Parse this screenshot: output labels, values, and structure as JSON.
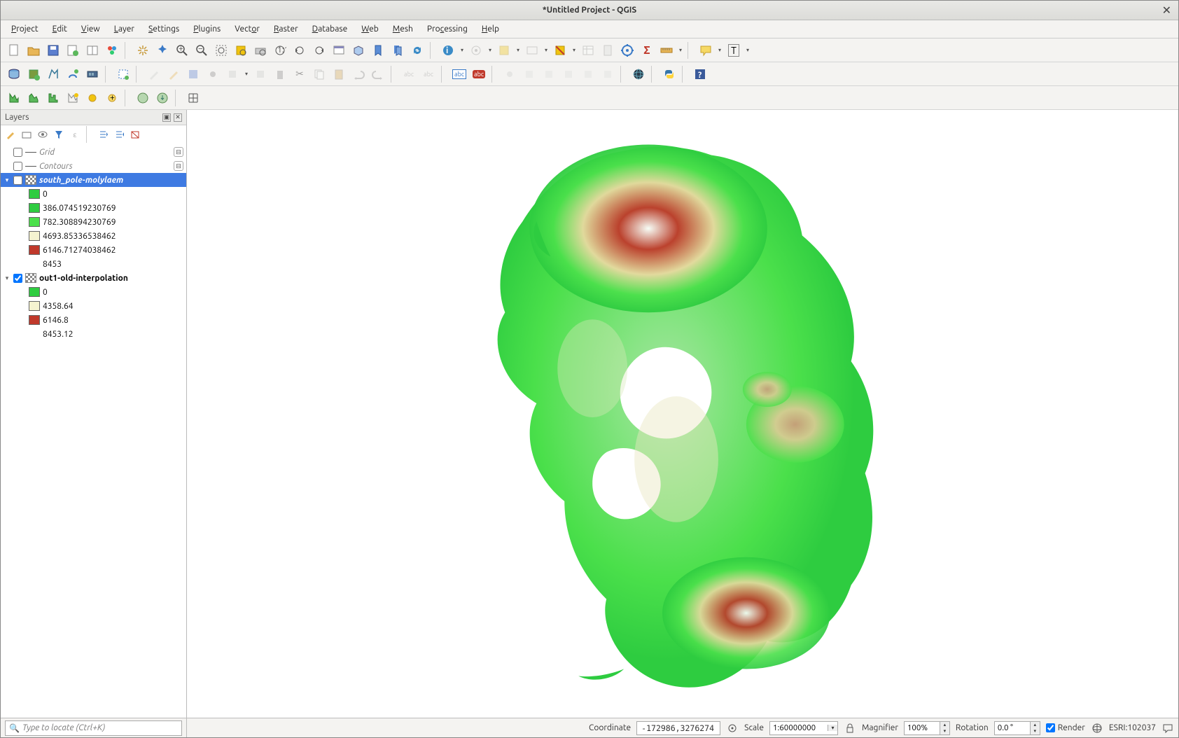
{
  "window": {
    "title": "*Untitled Project - QGIS"
  },
  "menu": [
    "Project",
    "Edit",
    "View",
    "Layer",
    "Settings",
    "Plugins",
    "Vector",
    "Raster",
    "Database",
    "Web",
    "Mesh",
    "Processing",
    "Help"
  ],
  "panel": {
    "title": "Layers"
  },
  "layers": {
    "grid": "Grid",
    "contours": "Contours",
    "south_pole": {
      "name": "south_pole-molylaem",
      "classes": [
        {
          "color": "#2ecc40",
          "label": "0"
        },
        {
          "color": "#2ecc40",
          "label": "386.074519230769"
        },
        {
          "color": "#4be04b",
          "label": "782.308894230769"
        },
        {
          "color": "#f5f3d0",
          "label": "4693.85336538462"
        },
        {
          "color": "#c0392b",
          "label": "6146.71274038462"
        },
        {
          "color": "transparent",
          "label": "8453"
        }
      ]
    },
    "out1": {
      "name": "out1-old-interpolation",
      "classes": [
        {
          "color": "#2ecc40",
          "label": "0"
        },
        {
          "color": "#f5f3d0",
          "label": "4358.64"
        },
        {
          "color": "#c0392b",
          "label": "6146.8"
        },
        {
          "color": "transparent",
          "label": "8453.12"
        }
      ]
    }
  },
  "locator": {
    "placeholder": "Type to locate (Ctrl+K)"
  },
  "status": {
    "coord_label": "Coordinate",
    "coord_value": "-172986,3276274",
    "scale_label": "Scale",
    "scale_value": "1:60000000",
    "magnifier_label": "Magnifier",
    "magnifier_value": "100%",
    "rotation_label": "Rotation",
    "rotation_value": "0.0 °",
    "render_label": "Render",
    "crs": "ESRI:102037"
  }
}
